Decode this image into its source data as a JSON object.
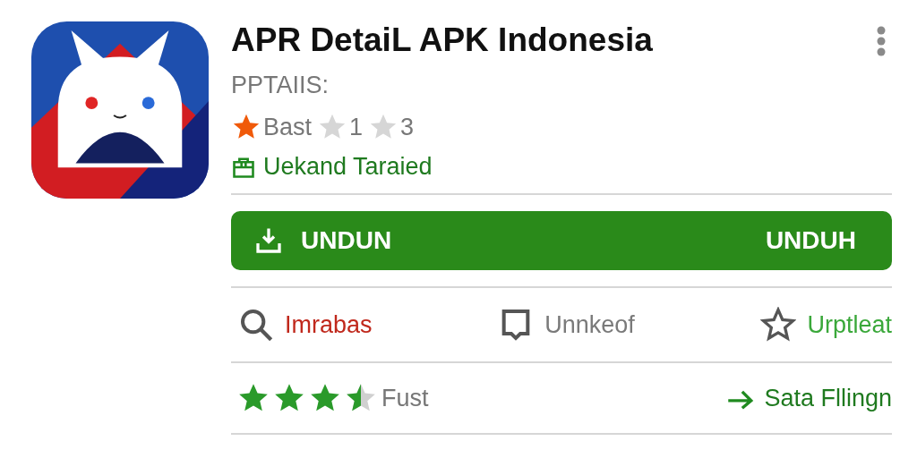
{
  "app": {
    "title": "APR DetaiL APK Indonesia",
    "subtitle": "PPTAIIS:"
  },
  "rating_chips": [
    {
      "label": "Bast",
      "filled": true
    },
    {
      "label": "1",
      "filled": false
    },
    {
      "label": "3",
      "filled": false
    }
  ],
  "badge": {
    "label": "Uekand Taraied"
  },
  "download_button": {
    "label": "UNDUN",
    "right_label": "UNDUH"
  },
  "actions": [
    {
      "kind": "search",
      "label": "Imrabas",
      "color": "#c0281c"
    },
    {
      "kind": "comment",
      "label": "Unnkeof",
      "color": "#7a7a7a"
    },
    {
      "kind": "star",
      "label": "Urptleat",
      "color": "#3aa83a"
    }
  ],
  "review": {
    "stars": 3.5,
    "label": "Fust",
    "link": "Sata Fllingn"
  }
}
